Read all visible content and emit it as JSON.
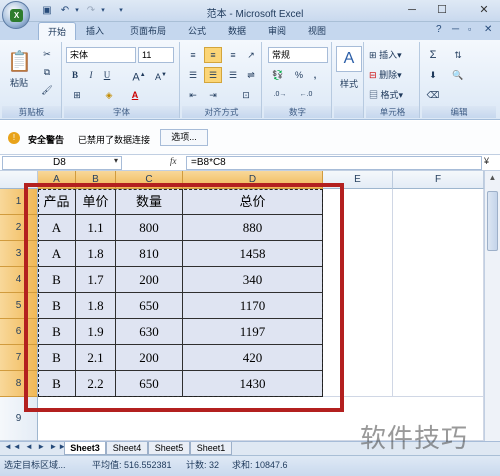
{
  "title": "范本 - Microsoft Excel",
  "tabs": [
    "开始",
    "插入",
    "页面布局",
    "公式",
    "数据",
    "审阅",
    "视图"
  ],
  "clipboard": {
    "paste": "粘贴",
    "label": "剪贴板"
  },
  "font": {
    "name": "宋体",
    "size": "11",
    "label": "字体",
    "bold": "B",
    "italic": "I",
    "underline": "U"
  },
  "alignment": {
    "label": "对齐方式"
  },
  "number": {
    "format": "常规",
    "label": "数字",
    "percent": "%",
    "comma": ","
  },
  "styles": {
    "label": "样式"
  },
  "cells": {
    "insert": "插入",
    "delete": "删除",
    "format": "格式",
    "label": "单元格"
  },
  "editing": {
    "sigma": "Σ",
    "label": "编辑"
  },
  "security": {
    "warning": "安全警告",
    "message": "已禁用了数据连接",
    "options": "选项..."
  },
  "formula": {
    "namebox": "D8",
    "fx": "fx",
    "content": "=B8*C8"
  },
  "columns": [
    "A",
    "B",
    "C",
    "D",
    "E",
    "F"
  ],
  "rows": [
    "1",
    "2",
    "3",
    "4",
    "5",
    "6",
    "7",
    "8",
    "9"
  ],
  "table": {
    "headers": [
      "产品",
      "单价",
      "数量",
      "总价"
    ],
    "rows": [
      [
        "A",
        "1.1",
        "800",
        "880"
      ],
      [
        "A",
        "1.8",
        "810",
        "1458"
      ],
      [
        "B",
        "1.7",
        "200",
        "340"
      ],
      [
        "B",
        "1.8",
        "650",
        "1170"
      ],
      [
        "B",
        "1.9",
        "630",
        "1197"
      ],
      [
        "B",
        "2.1",
        "200",
        "420"
      ],
      [
        "B",
        "2.2",
        "650",
        "1430"
      ]
    ]
  },
  "sheets": [
    "Sheet3",
    "Sheet4",
    "Sheet5",
    "Sheet1"
  ],
  "status": {
    "mode": "选定目标区域...",
    "average": "平均值: 516.552381",
    "count": "计数: 32",
    "sum": "求和: 10847.6"
  },
  "watermark": "软件技巧",
  "colors": {
    "accent_red": "#b3201f",
    "selected_header": "#f1b856",
    "cell_fill": "#dfe4f2"
  }
}
